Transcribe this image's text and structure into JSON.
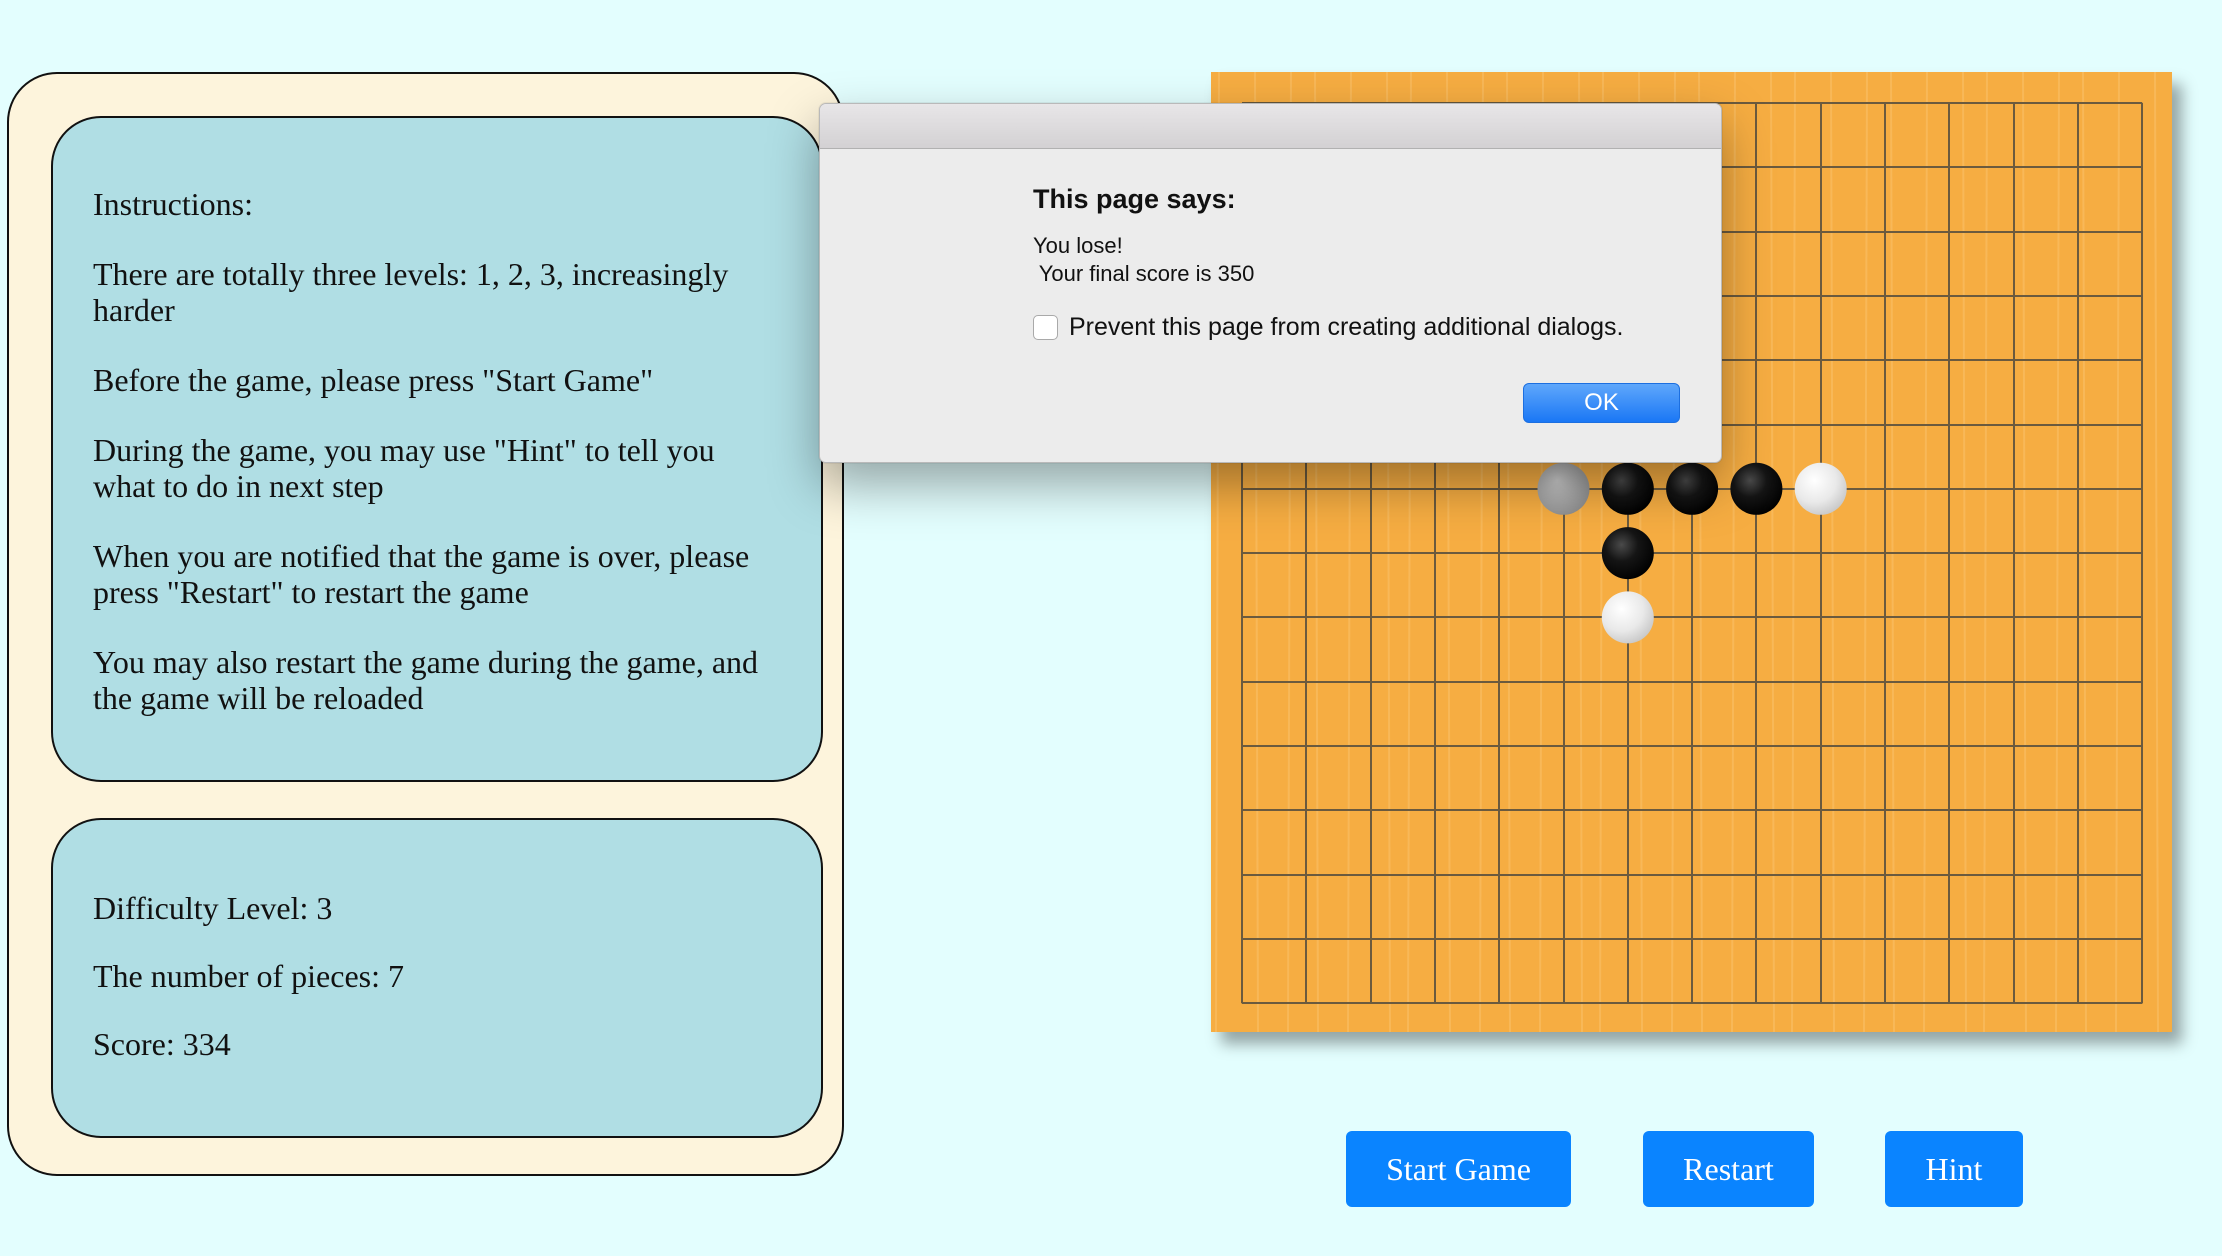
{
  "instructions": {
    "heading": "Instructions:",
    "lines": [
      "There are totally three levels: 1, 2, 3, increasingly harder",
      "Before the game, please press \"Start Game\"",
      "During the game, you may use \"Hint\" to tell you what to do in next step",
      "When you are notified that the game is over, please press \"Restart\" to restart the game",
      "You may also restart the game during the game, and the game will be reloaded"
    ]
  },
  "status": {
    "difficulty": "Difficulty Level: 3",
    "pieces": "The number of pieces: 7",
    "score": "Score: 334"
  },
  "buttons": {
    "start": "Start Game",
    "restart": "Restart",
    "hint": "Hint"
  },
  "board": {
    "size": 15,
    "wood_color": "#f6ad42",
    "line_color": "#6b5a3e",
    "stones": [
      {
        "row": 6,
        "col": 5,
        "color": "gray"
      },
      {
        "row": 6,
        "col": 6,
        "color": "black"
      },
      {
        "row": 6,
        "col": 7,
        "color": "black"
      },
      {
        "row": 6,
        "col": 8,
        "color": "black"
      },
      {
        "row": 6,
        "col": 9,
        "color": "white"
      },
      {
        "row": 7,
        "col": 6,
        "color": "black"
      },
      {
        "row": 8,
        "col": 6,
        "color": "white"
      }
    ]
  },
  "dialog": {
    "heading": "This page says:",
    "message": "You lose!\n Your final score is 350",
    "checkbox_label": "Prevent this page from creating additional dialogs.",
    "checkbox_checked": false,
    "ok_label": "OK",
    "accent_color": "#1a77f5"
  }
}
